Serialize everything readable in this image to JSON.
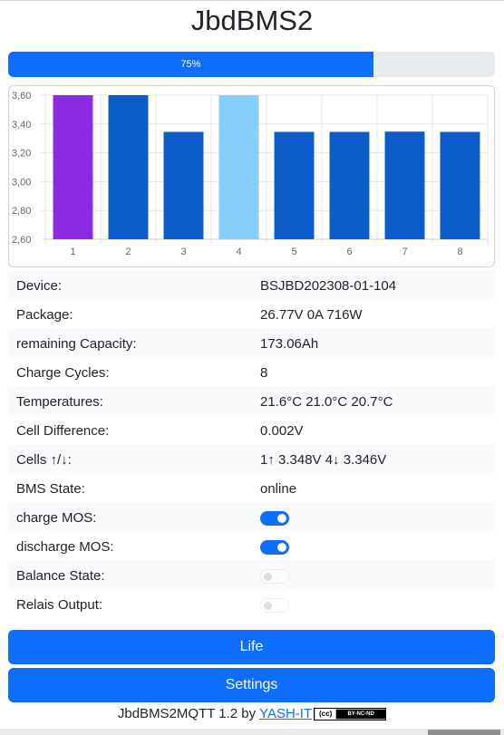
{
  "title": "JbdBMS2",
  "progress": {
    "label": "75%",
    "value": 0.75
  },
  "chart_data": {
    "type": "bar",
    "categories": [
      "1",
      "2",
      "3",
      "4",
      "5",
      "6",
      "7",
      "8"
    ],
    "values": [
      3.6,
      3.6,
      3.345,
      3.6,
      3.345,
      3.345,
      3.347,
      3.345
    ],
    "colors": [
      "#8a2be2",
      "#0b5bc9",
      "#0b5bc9",
      "#87cefa",
      "#0b5bc9",
      "#0b5bc9",
      "#0b5bc9",
      "#0b5bc9"
    ],
    "ylim": [
      2.6,
      3.6
    ],
    "y_ticks": [
      "2,60",
      "2,80",
      "3,00",
      "3,20",
      "3,40",
      "3,60"
    ],
    "grid": true
  },
  "info": [
    {
      "label": "Device:",
      "value": "BSJBD202308-01-104"
    },
    {
      "label": "Package:",
      "value": "26.77V 0A 716W"
    },
    {
      "label": "remaining Capacity:",
      "value": "173.06Ah"
    },
    {
      "label": "Charge Cycles:",
      "value": "8"
    },
    {
      "label": "Temperatures:",
      "value": "21.6°C 21.0°C 20.7°C"
    },
    {
      "label": "Cell Difference:",
      "value": "0.002V"
    },
    {
      "label": "Cells ↑/↓:",
      "value": "1↑ 3.348V 4↓ 3.346V"
    },
    {
      "label": "BMS State:",
      "value": "online"
    }
  ],
  "toggles": [
    {
      "label": "charge MOS:",
      "state": "on"
    },
    {
      "label": "discharge MOS:",
      "state": "on"
    },
    {
      "label": "Balance State:",
      "state": "off-disabled"
    },
    {
      "label": "Relais Output:",
      "state": "off-disabled"
    }
  ],
  "buttons": {
    "life": "Life",
    "settings": "Settings"
  },
  "footer": {
    "text": "JbdBMS2MQTT 1.2 by ",
    "link": "YASH-IT",
    "license_cc": "(cc)",
    "license_terms": "BY-NC-ND"
  }
}
